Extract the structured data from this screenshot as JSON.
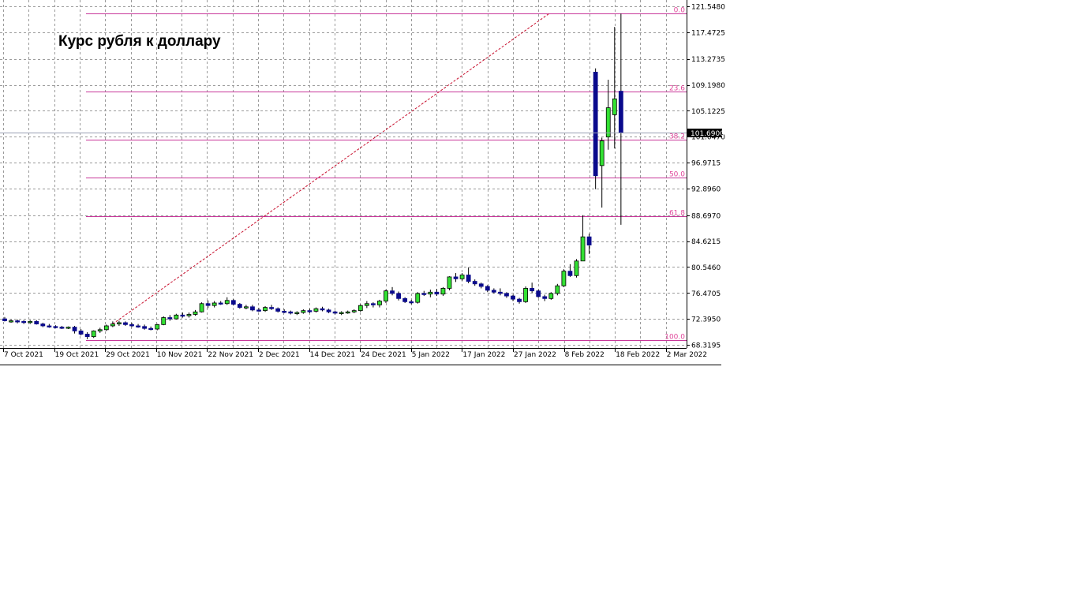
{
  "chart_data": {
    "type": "candlestick",
    "title": "Курс рубля к доллару",
    "ylim": [
      68.3195,
      121.548
    ],
    "y_ticks": [
      "121.5480",
      "117.4725",
      "113.2735",
      "109.1980",
      "105.1225",
      "101.0470",
      "96.9715",
      "92.8960",
      "88.6970",
      "84.6215",
      "80.5460",
      "76.4705",
      "72.3950",
      "68.3195"
    ],
    "x_ticks": [
      "7 Oct 2021",
      "19 Oct 2021",
      "29 Oct 2021",
      "10 Nov 2021",
      "22 Nov 2021",
      "2 Dec 2021",
      "14 Dec 2021",
      "24 Dec 2021",
      "5 Jan 2022",
      "17 Jan 2022",
      "27 Jan 2022",
      "8 Feb 2022",
      "18 Feb 2022",
      "2 Mar 2022"
    ],
    "current_price": "101.6900",
    "fibonacci": {
      "levels": [
        {
          "label": "0.0",
          "value": 120.4
        },
        {
          "label": "23.6",
          "value": 108.2
        },
        {
          "label": "38.2",
          "value": 100.6
        },
        {
          "label": "50.0",
          "value": 94.6
        },
        {
          "label": "61.8",
          "value": 88.5
        },
        {
          "label": "100.0",
          "value": 69.1
        }
      ],
      "trend_from": {
        "candle_index": 17,
        "value": 71.6
      },
      "trend_to": {
        "candle_index": 95,
        "value": 120.4
      }
    },
    "candles": [
      {
        "o": 72.4,
        "h": 72.7,
        "l": 72.0,
        "c": 72.1
      },
      {
        "o": 72.1,
        "h": 72.3,
        "l": 71.8,
        "c": 72.1
      },
      {
        "o": 72.1,
        "h": 72.3,
        "l": 71.7,
        "c": 72.0
      },
      {
        "o": 72.0,
        "h": 72.2,
        "l": 71.6,
        "c": 71.9
      },
      {
        "o": 71.9,
        "h": 72.2,
        "l": 71.6,
        "c": 72.0
      },
      {
        "o": 72.0,
        "h": 72.2,
        "l": 71.5,
        "c": 71.6
      },
      {
        "o": 71.6,
        "h": 71.8,
        "l": 71.1,
        "c": 71.3
      },
      {
        "o": 71.3,
        "h": 71.6,
        "l": 71.0,
        "c": 71.2
      },
      {
        "o": 71.2,
        "h": 71.4,
        "l": 70.9,
        "c": 71.1
      },
      {
        "o": 71.1,
        "h": 71.3,
        "l": 70.8,
        "c": 71.0
      },
      {
        "o": 71.0,
        "h": 71.2,
        "l": 70.8,
        "c": 71.1
      },
      {
        "o": 71.1,
        "h": 71.3,
        "l": 70.1,
        "c": 70.5
      },
      {
        "o": 70.5,
        "h": 70.8,
        "l": 69.8,
        "c": 70.0
      },
      {
        "o": 70.0,
        "h": 70.3,
        "l": 69.2,
        "c": 69.6
      },
      {
        "o": 69.6,
        "h": 70.6,
        "l": 69.4,
        "c": 70.5
      },
      {
        "o": 70.5,
        "h": 71.0,
        "l": 70.2,
        "c": 70.7
      },
      {
        "o": 70.7,
        "h": 71.5,
        "l": 70.5,
        "c": 71.3
      },
      {
        "o": 71.3,
        "h": 72.0,
        "l": 71.1,
        "c": 71.6
      },
      {
        "o": 71.6,
        "h": 72.1,
        "l": 71.3,
        "c": 71.8
      },
      {
        "o": 71.8,
        "h": 72.0,
        "l": 71.3,
        "c": 71.5
      },
      {
        "o": 71.5,
        "h": 71.8,
        "l": 71.1,
        "c": 71.3
      },
      {
        "o": 71.3,
        "h": 71.6,
        "l": 71.0,
        "c": 71.2
      },
      {
        "o": 71.2,
        "h": 71.5,
        "l": 70.7,
        "c": 70.9
      },
      {
        "o": 70.9,
        "h": 71.2,
        "l": 70.6,
        "c": 70.8
      },
      {
        "o": 70.8,
        "h": 71.6,
        "l": 70.6,
        "c": 71.5
      },
      {
        "o": 71.5,
        "h": 72.8,
        "l": 71.4,
        "c": 72.6
      },
      {
        "o": 72.6,
        "h": 73.0,
        "l": 72.1,
        "c": 72.4
      },
      {
        "o": 72.4,
        "h": 73.2,
        "l": 72.3,
        "c": 73.0
      },
      {
        "o": 73.0,
        "h": 73.4,
        "l": 72.6,
        "c": 72.9
      },
      {
        "o": 72.9,
        "h": 73.4,
        "l": 72.6,
        "c": 73.1
      },
      {
        "o": 73.1,
        "h": 73.8,
        "l": 72.9,
        "c": 73.5
      },
      {
        "o": 73.5,
        "h": 75.0,
        "l": 73.4,
        "c": 74.8
      },
      {
        "o": 74.8,
        "h": 75.3,
        "l": 74.1,
        "c": 74.5
      },
      {
        "o": 74.5,
        "h": 75.2,
        "l": 74.2,
        "c": 74.9
      },
      {
        "o": 74.9,
        "h": 75.2,
        "l": 74.6,
        "c": 74.8
      },
      {
        "o": 74.8,
        "h": 75.8,
        "l": 74.6,
        "c": 75.3
      },
      {
        "o": 75.3,
        "h": 75.5,
        "l": 74.5,
        "c": 74.7
      },
      {
        "o": 74.7,
        "h": 74.9,
        "l": 74.0,
        "c": 74.2
      },
      {
        "o": 74.2,
        "h": 74.6,
        "l": 73.9,
        "c": 74.3
      },
      {
        "o": 74.3,
        "h": 74.6,
        "l": 73.6,
        "c": 73.8
      },
      {
        "o": 73.8,
        "h": 74.1,
        "l": 73.5,
        "c": 73.7
      },
      {
        "o": 73.7,
        "h": 74.4,
        "l": 73.5,
        "c": 74.2
      },
      {
        "o": 74.2,
        "h": 74.6,
        "l": 73.8,
        "c": 74.0
      },
      {
        "o": 74.0,
        "h": 74.2,
        "l": 73.4,
        "c": 73.6
      },
      {
        "o": 73.6,
        "h": 73.9,
        "l": 73.3,
        "c": 73.5
      },
      {
        "o": 73.5,
        "h": 73.7,
        "l": 73.1,
        "c": 73.3
      },
      {
        "o": 73.3,
        "h": 73.6,
        "l": 73.0,
        "c": 73.4
      },
      {
        "o": 73.4,
        "h": 73.9,
        "l": 73.2,
        "c": 73.7
      },
      {
        "o": 73.7,
        "h": 74.0,
        "l": 73.3,
        "c": 73.6
      },
      {
        "o": 73.6,
        "h": 74.2,
        "l": 73.4,
        "c": 74.0
      },
      {
        "o": 74.0,
        "h": 74.3,
        "l": 73.6,
        "c": 73.8
      },
      {
        "o": 73.8,
        "h": 74.0,
        "l": 73.3,
        "c": 73.5
      },
      {
        "o": 73.5,
        "h": 73.7,
        "l": 73.1,
        "c": 73.3
      },
      {
        "o": 73.3,
        "h": 73.6,
        "l": 73.0,
        "c": 73.4
      },
      {
        "o": 73.4,
        "h": 73.7,
        "l": 73.2,
        "c": 73.5
      },
      {
        "o": 73.5,
        "h": 73.9,
        "l": 73.3,
        "c": 73.7
      },
      {
        "o": 73.7,
        "h": 74.7,
        "l": 73.5,
        "c": 74.5
      },
      {
        "o": 74.5,
        "h": 75.2,
        "l": 74.1,
        "c": 74.8
      },
      {
        "o": 74.8,
        "h": 75.0,
        "l": 74.2,
        "c": 74.6
      },
      {
        "o": 74.6,
        "h": 75.4,
        "l": 74.2,
        "c": 75.2
      },
      {
        "o": 75.2,
        "h": 77.0,
        "l": 74.9,
        "c": 76.8
      },
      {
        "o": 76.8,
        "h": 77.4,
        "l": 76.1,
        "c": 76.4
      },
      {
        "o": 76.4,
        "h": 76.7,
        "l": 75.3,
        "c": 75.6
      },
      {
        "o": 75.6,
        "h": 75.8,
        "l": 74.9,
        "c": 75.1
      },
      {
        "o": 75.1,
        "h": 75.4,
        "l": 74.7,
        "c": 75.0
      },
      {
        "o": 75.0,
        "h": 76.6,
        "l": 74.8,
        "c": 76.4
      },
      {
        "o": 76.4,
        "h": 76.8,
        "l": 76.0,
        "c": 76.3
      },
      {
        "o": 76.3,
        "h": 77.0,
        "l": 75.8,
        "c": 76.6
      },
      {
        "o": 76.6,
        "h": 77.1,
        "l": 76.0,
        "c": 76.3
      },
      {
        "o": 76.3,
        "h": 77.4,
        "l": 76.0,
        "c": 77.2
      },
      {
        "o": 77.2,
        "h": 79.1,
        "l": 76.9,
        "c": 79.0
      },
      {
        "o": 79.0,
        "h": 79.6,
        "l": 78.2,
        "c": 78.7
      },
      {
        "o": 78.7,
        "h": 79.6,
        "l": 78.4,
        "c": 79.3
      },
      {
        "o": 79.3,
        "h": 80.5,
        "l": 78.0,
        "c": 78.3
      },
      {
        "o": 78.3,
        "h": 78.6,
        "l": 77.6,
        "c": 77.9
      },
      {
        "o": 77.9,
        "h": 78.1,
        "l": 77.2,
        "c": 77.5
      },
      {
        "o": 77.5,
        "h": 77.7,
        "l": 76.6,
        "c": 76.9
      },
      {
        "o": 76.9,
        "h": 77.2,
        "l": 76.4,
        "c": 76.6
      },
      {
        "o": 76.6,
        "h": 77.2,
        "l": 76.1,
        "c": 76.4
      },
      {
        "o": 76.4,
        "h": 76.6,
        "l": 75.7,
        "c": 76.0
      },
      {
        "o": 76.0,
        "h": 76.2,
        "l": 75.2,
        "c": 75.5
      },
      {
        "o": 75.5,
        "h": 75.7,
        "l": 74.8,
        "c": 75.1
      },
      {
        "o": 75.1,
        "h": 77.5,
        "l": 74.9,
        "c": 77.2
      },
      {
        "o": 77.2,
        "h": 78.1,
        "l": 76.5,
        "c": 76.8
      },
      {
        "o": 76.8,
        "h": 77.0,
        "l": 75.7,
        "c": 75.9
      },
      {
        "o": 75.9,
        "h": 76.2,
        "l": 75.2,
        "c": 75.6
      },
      {
        "o": 75.6,
        "h": 76.6,
        "l": 75.4,
        "c": 76.4
      },
      {
        "o": 76.4,
        "h": 77.9,
        "l": 76.1,
        "c": 77.6
      },
      {
        "o": 77.6,
        "h": 80.2,
        "l": 77.4,
        "c": 79.9
      },
      {
        "o": 79.9,
        "h": 81.0,
        "l": 79.0,
        "c": 79.2
      },
      {
        "o": 79.2,
        "h": 81.8,
        "l": 78.9,
        "c": 81.5
      },
      {
        "o": 81.5,
        "h": 88.7,
        "l": 82.8,
        "c": 85.3
      },
      {
        "o": 85.3,
        "h": 85.8,
        "l": 82.6,
        "c": 84.0
      },
      {
        "o": 111.2,
        "h": 111.8,
        "l": 92.8,
        "c": 94.9
      },
      {
        "o": 96.5,
        "h": 100.9,
        "l": 89.9,
        "c": 100.4
      },
      {
        "o": 101.0,
        "h": 110.0,
        "l": 99.0,
        "c": 105.6
      },
      {
        "o": 104.5,
        "h": 118.3,
        "l": 99.2,
        "c": 107.0
      },
      {
        "o": 108.2,
        "h": 120.4,
        "l": 87.2,
        "c": 101.7
      }
    ]
  }
}
